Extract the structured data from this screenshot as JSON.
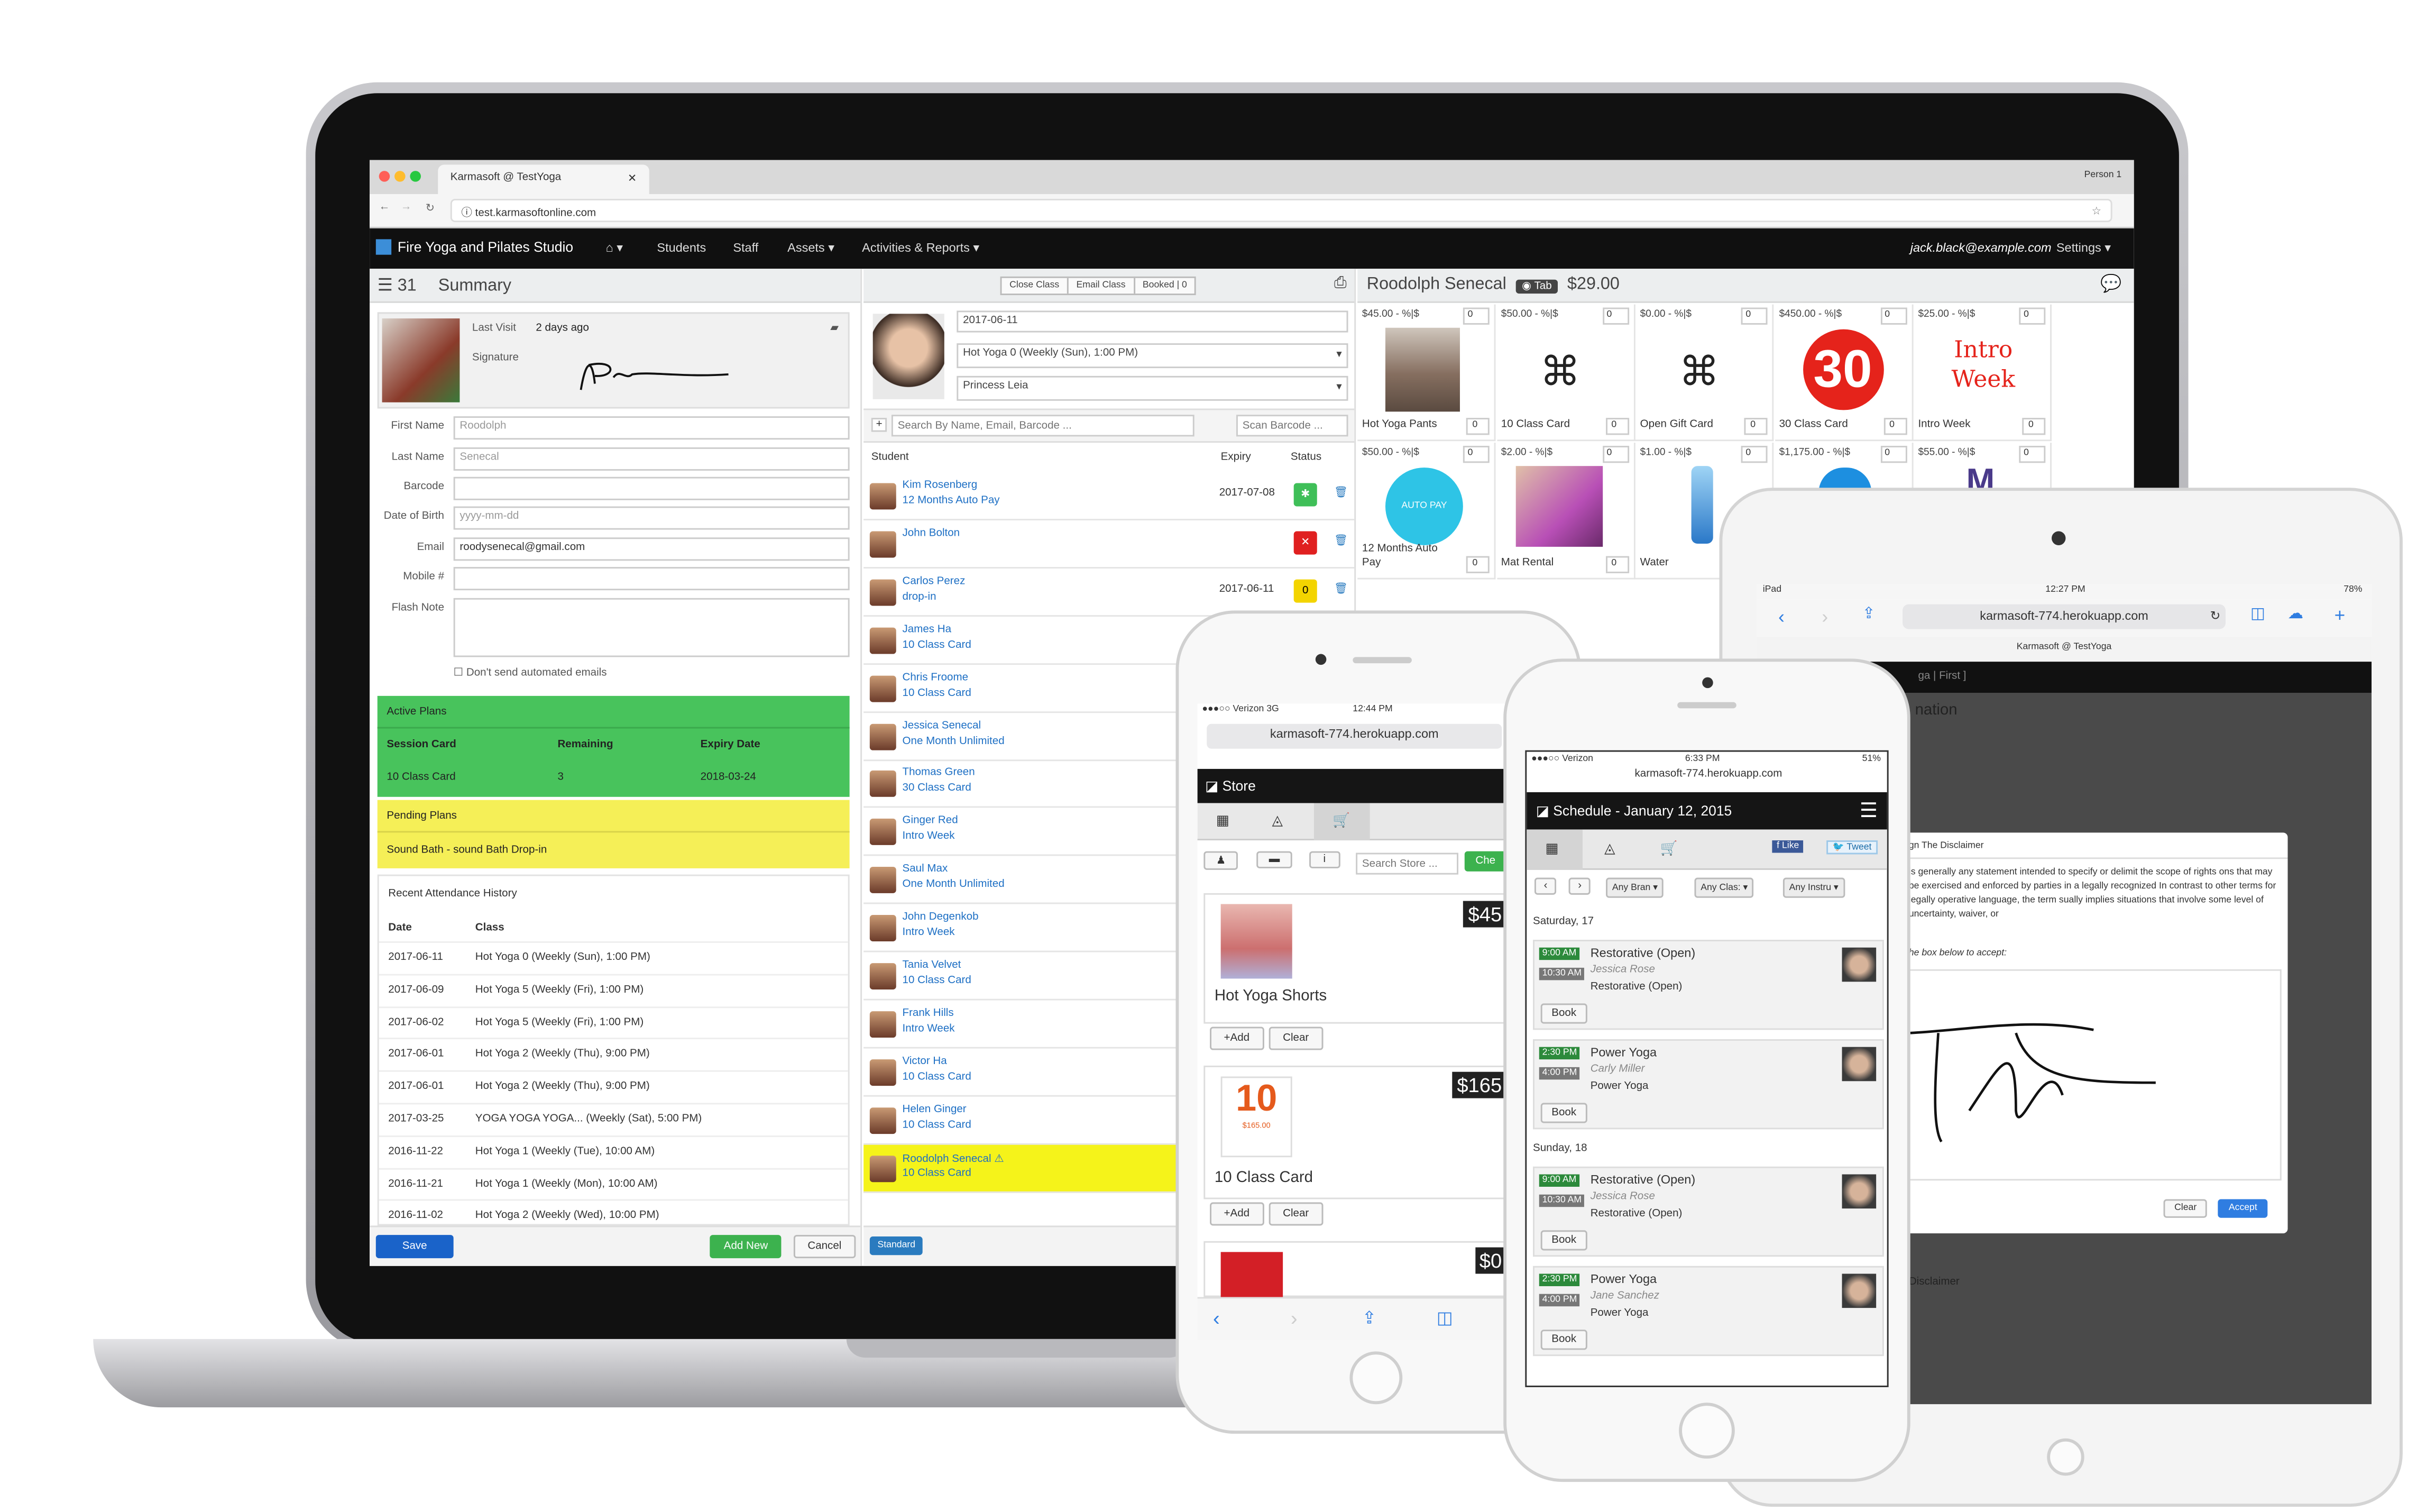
{
  "browser": {
    "tab_title": "Karmasoft @ TestYoga",
    "profile": "Person 1",
    "url": "test.karmasoftonline.com"
  },
  "nav": {
    "brand": "Fire Yoga and Pilates Studio",
    "items": [
      "Students",
      "Staff",
      "Assets ▾",
      "Activities & Reports ▾"
    ],
    "user": "jack.black@example.com",
    "settings": "Settings ▾"
  },
  "summary": {
    "count": "31",
    "title": "Summary",
    "last_visit_label": "Last Visit",
    "last_visit": "2 days ago",
    "signature_label": "Signature",
    "fields": [
      {
        "label": "First Name",
        "value": "Roodolph"
      },
      {
        "label": "Last Name",
        "value": "Senecal"
      },
      {
        "label": "Barcode",
        "value": ""
      },
      {
        "label": "Date of Birth",
        "value": "yyyy-mm-dd"
      },
      {
        "label": "Email",
        "value": "roodysenecal@gmail.com"
      },
      {
        "label": "Mobile #",
        "value": ""
      },
      {
        "label": "Flash Note",
        "value": ""
      }
    ],
    "no_emails": "Don't send automated emails",
    "active_plans": {
      "title": "Active Plans",
      "headers": [
        "Session Card",
        "Remaining",
        "Expiry Date"
      ],
      "row": [
        "10 Class Card",
        "3",
        "2018-03-24"
      ]
    },
    "pending_plans": {
      "title": "Pending Plans",
      "row": "Sound Bath - sound Bath Drop-in"
    },
    "history": {
      "title": "Recent Attendance History",
      "headers": [
        "Date",
        "Class"
      ],
      "rows": [
        [
          "2017-06-11",
          "Hot Yoga 0 (Weekly (Sun), 1:00 PM)"
        ],
        [
          "2017-06-09",
          "Hot Yoga 5 (Weekly (Fri), 1:00 PM)"
        ],
        [
          "2017-06-02",
          "Hot Yoga 5 (Weekly (Fri), 1:00 PM)"
        ],
        [
          "2017-06-01",
          "Hot Yoga 2 (Weekly (Thu), 9:00 PM)"
        ],
        [
          "2017-06-01",
          "Hot Yoga 2 (Weekly (Thu), 9:00 PM)"
        ],
        [
          "2017-03-25",
          "YOGA YOGA YOGA... (Weekly (Sat), 5:00 PM)"
        ],
        [
          "2016-11-22",
          "Hot Yoga 1 (Weekly (Tue), 10:00 AM)"
        ],
        [
          "2016-11-21",
          "Hot Yoga 1 (Weekly (Mon), 10:00 AM)"
        ],
        [
          "2016-11-02",
          "Hot Yoga 2 (Weekly (Wed), 10:00 PM)"
        ]
      ]
    },
    "save": "Save",
    "add_new": "Add New",
    "cancel": "Cancel"
  },
  "classpanel": {
    "close_class": "Close Class",
    "email_class": "Email Class",
    "booked": "Booked | 0",
    "date": "2017-06-11",
    "class": "Hot Yoga 0 (Weekly (Sun), 1:00 PM)",
    "teacher": "Princess Leia",
    "search_placeholder": "Search By Name, Email, Barcode ...",
    "scan": "Scan Barcode ...",
    "headers": [
      "Student",
      "Expiry",
      "Status"
    ],
    "students": [
      {
        "name": "Kim Rosenberg",
        "plan": "12 Months Auto Pay",
        "expiry": "2017-07-08",
        "status": "✱",
        "color": "#3fbf58"
      },
      {
        "name": "John Bolton",
        "plan": "",
        "expiry": "",
        "status": "✕",
        "color": "#e02020"
      },
      {
        "name": "Carlos Perez",
        "plan": "drop-in",
        "expiry": "2017-06-11",
        "status": "0",
        "color": "#f3d400"
      },
      {
        "name": "James Ha",
        "plan": "10 Class Card"
      },
      {
        "name": "Chris Froome",
        "plan": "10 Class Card"
      },
      {
        "name": "Jessica Senecal",
        "plan": "One Month Unlimited"
      },
      {
        "name": "Thomas Green",
        "plan": "30 Class Card"
      },
      {
        "name": "Ginger Red",
        "plan": "Intro Week"
      },
      {
        "name": "Saul Max",
        "plan": "One Month Unlimited"
      },
      {
        "name": "John Degenkob",
        "plan": "Intro Week"
      },
      {
        "name": "Tania Velvet",
        "plan": "10 Class Card"
      },
      {
        "name": "Frank Hills",
        "plan": "Intro Week"
      },
      {
        "name": "Victor Ha",
        "plan": "10 Class Card"
      },
      {
        "name": "Helen Ginger",
        "plan": "10 Class Card"
      },
      {
        "name": "Roodolph Senecal ⚠",
        "plan": "10 Class Card"
      }
    ],
    "standard": "Standard"
  },
  "store": {
    "customer": "Roodolph Senecal",
    "tab": "Tab",
    "total": "$29.00",
    "items": [
      {
        "price": "$45.00 - %|$",
        "name": "Hot Yoga Pants",
        "qty": "0"
      },
      {
        "price": "$50.00 - %|$",
        "name": "10 Class Card",
        "qty": "0"
      },
      {
        "price": "$0.00 - %|$",
        "name": "Open Gift Card",
        "qty": "0"
      },
      {
        "price": "$450.00 - %|$",
        "name": "30 Class Card",
        "qty": "0"
      },
      {
        "price": "$25.00 - %|$",
        "name": "Intro Week",
        "qty": "0"
      },
      {
        "price": "$50.00 - %|$",
        "name": "12 Months Auto Pay",
        "qty": "0"
      },
      {
        "price": "$2.00 - %|$",
        "name": "Mat Rental",
        "qty": "0"
      },
      {
        "price": "$1.00 - %|$",
        "name": "Water",
        "qty": "0"
      },
      {
        "price": "$1,175.00 - %|$",
        "name": "",
        "qty": "0"
      },
      {
        "price": "$55.00 - %|$",
        "name": "",
        "qty": "0"
      }
    ],
    "thumb_30": "30",
    "thumb_intro": "Intro Week",
    "thumb_auto": "AUTO PAY"
  },
  "tablet": {
    "device": "iPad",
    "time": "12:27 PM",
    "battery": "78%",
    "url": "karmasoft-774.herokuapp.com",
    "site": "Karmasoft @ TestYoga",
    "frag1": "ga | First ]",
    "frag2": "nation",
    "modal_title": "gn The Disclaimer",
    "modal_text": "is generally any statement intended to specify or delimit the scope of rights ons that may be exercised and enforced by parties in a legally recognized In contrast to other terms for legally operative language, the term sually implies situations that involve some level of uncertainty, waiver, or",
    "modal_prompt": "he box below to accept:",
    "clear": "Clear",
    "accept": "Accept",
    "frag3": "Disclaimer"
  },
  "phone1": {
    "carrier": "●●●○○ Verizon 3G",
    "time": "12:44 PM",
    "url": "karmasoft-774.herokuapp.com",
    "title": "Store",
    "search": "Search Store ...",
    "check": "Che",
    "items": [
      {
        "name": "Hot Yoga Shorts",
        "price": "$45"
      },
      {
        "name": "10 Class Card",
        "price": "$165"
      },
      {
        "name": "",
        "price": "$0"
      }
    ],
    "add": "+Add",
    "clear": "Clear",
    "card_num": "10",
    "card_price": "$165.00"
  },
  "phone2": {
    "carrier": "●●●○○ Verizon",
    "time": "6:33 PM",
    "battery": "51%",
    "url": "karmasoft-774.herokuapp.com",
    "title": "Schedule - January 12, 2015",
    "like": "Like",
    "tweet": "Tweet",
    "filters": [
      "Any Bran ▾",
      "Any Clas: ▾",
      "Any Instru ▾"
    ],
    "days": [
      {
        "day": "Saturday, 17",
        "classes": [
          {
            "start": "9:00 AM",
            "end": "10:30 AM",
            "name": "Restorative (Open)",
            "teacher": "Jessica Rose",
            "sub": "Restorative (Open)"
          },
          {
            "start": "2:30 PM",
            "end": "4:00 PM",
            "name": "Power Yoga",
            "teacher": "Carly Miller",
            "sub": "Power Yoga"
          }
        ]
      },
      {
        "day": "Sunday, 18",
        "classes": [
          {
            "start": "9:00 AM",
            "end": "10:30 AM",
            "name": "Restorative (Open)",
            "teacher": "Jessica Rose",
            "sub": "Restorative (Open)"
          },
          {
            "start": "2:30 PM",
            "end": "4:00 PM",
            "name": "Power Yoga",
            "teacher": "Jane Sanchez",
            "sub": "Power Yoga"
          }
        ]
      }
    ],
    "book": "Book"
  }
}
